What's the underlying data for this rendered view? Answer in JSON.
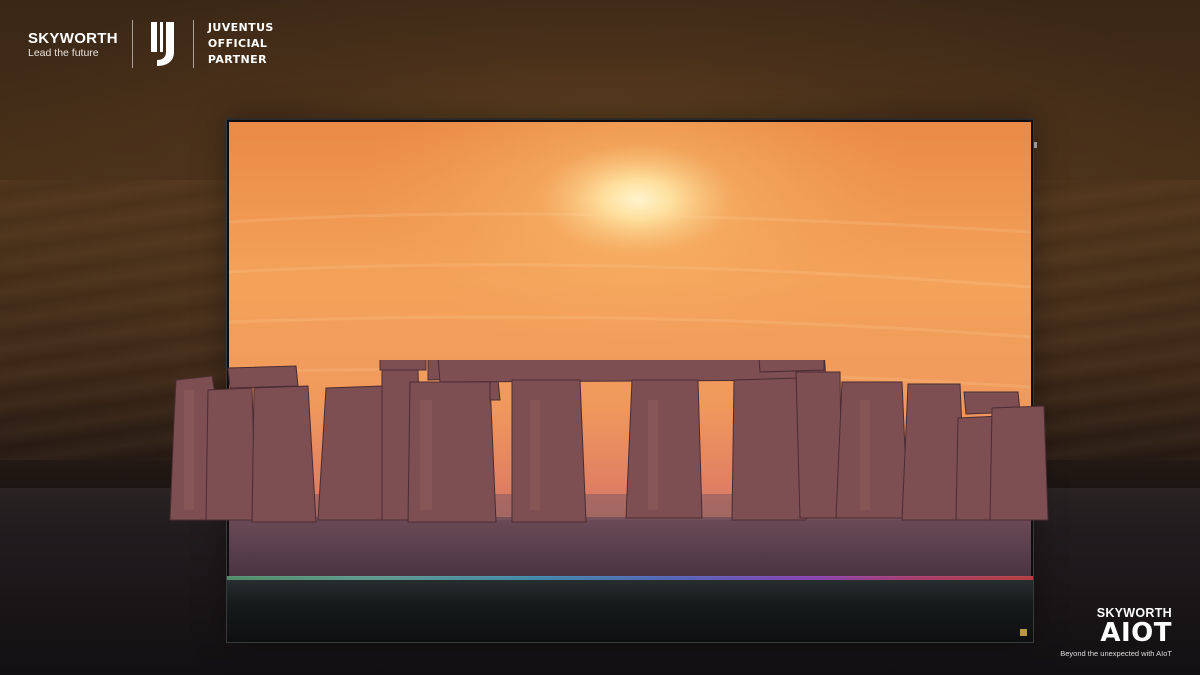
{
  "brand": {
    "name": "SKYWORTH",
    "tagline": "Lead the future",
    "partner_lines": [
      "JUVENTUS",
      "OFFICIAL",
      "PARTNER"
    ]
  },
  "footer_brand": {
    "name": "SKYWORTH",
    "logo_text": "AIOT",
    "tagline": "Beyond the unexpected with AIoT"
  },
  "colors": {
    "sky_top": "#f0a05a",
    "sun": "#fff1c4",
    "stone": "#7a4b4e",
    "ground": "#5a3e4a"
  },
  "icons": {
    "juventus_logo": "juventus-j-logo"
  }
}
